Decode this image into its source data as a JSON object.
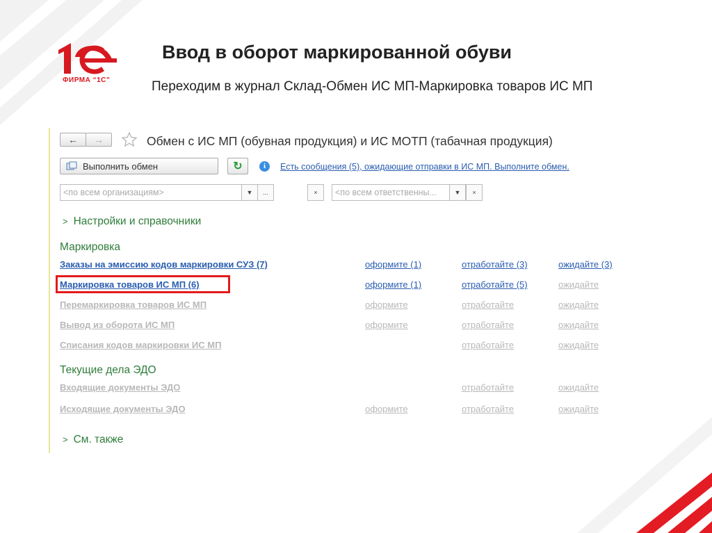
{
  "slide": {
    "title": "Ввод в оборот маркированной обуви",
    "subtitle": "Переходим в журнал Склад-Обмен  ИС МП-Маркировка товаров ИС МП",
    "logo_caption": "ФИРМА “1С”",
    "brand_color": "#d71920"
  },
  "app": {
    "back_label": "←",
    "forward_label": "→",
    "title": "Обмен с ИС МП (обувная продукция) и ИС МОТП (табачная продукция)",
    "exec_button": "Выполнить обмен",
    "refresh_icon": "↻",
    "info_icon": "i",
    "info_link": "Есть сообщения (5), ожидающие отправки в ИС МП. Выполните обмен.",
    "org_filter_placeholder": "<по всем организациям>",
    "resp_filter_placeholder": "<по всем ответственны...",
    "dropdown_glyph": "▼",
    "more_glyph": "...",
    "clear_glyph": "×",
    "settings_section": "Настройки и справочники",
    "see_also_section": "См. также",
    "chevron": ">",
    "marking_group": "Маркировка",
    "edo_group": "Текущие дела ЭДО",
    "rows": [
      {
        "label": "Заказы на эмиссию кодов маркировки СУЗ (7)",
        "c1": "оформите (1)",
        "c2": "отработайте (3)",
        "c3": "ожидайте (3)"
      },
      {
        "label": "Маркировка товаров ИС МП (6)",
        "c1": "оформите (1)",
        "c2": "отработайте (5)",
        "c3": "ожидайте"
      },
      {
        "label": "Перемаркировка товаров ИС МП",
        "c1": "оформите",
        "c2": "отработайте",
        "c3": "ожидайте"
      },
      {
        "label": "Вывод из оборота ИС МП",
        "c1": "оформите",
        "c2": "отработайте",
        "c3": "ожидайте"
      },
      {
        "label": "Списания кодов маркировки ИС МП",
        "c1": "",
        "c2": "отработайте",
        "c3": "ожидайте"
      }
    ],
    "edo_rows": [
      {
        "label": "Входящие документы ЭДО",
        "c1": "",
        "c2": "отработайте",
        "c3": "ожидайте"
      },
      {
        "label": "Исходящие документы ЭДО",
        "c1": "оформите",
        "c2": "отработайте",
        "c3": "ожидайте"
      }
    ],
    "link_color": "#2a5db0",
    "section_color": "#2f7d3a",
    "highlight_color": "#e21b1b"
  }
}
